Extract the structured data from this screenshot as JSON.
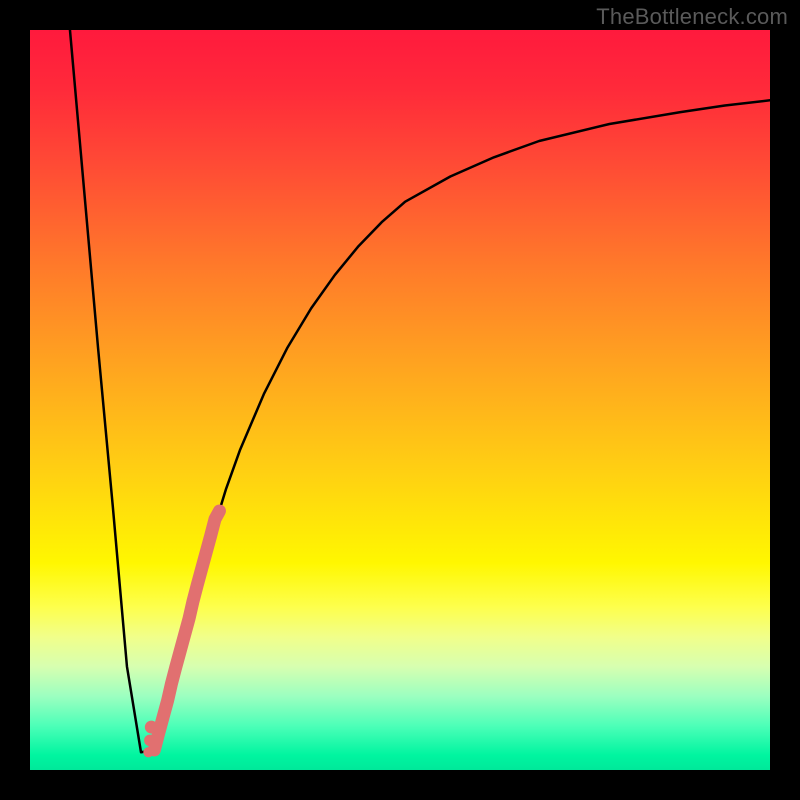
{
  "watermark": "TheBottleneck.com",
  "chart_data": {
    "type": "line",
    "title": "",
    "xlabel": "",
    "ylabel": "",
    "xlim": [
      0,
      100
    ],
    "ylim": [
      0,
      100
    ],
    "series": [
      {
        "name": "bottleneck-curve",
        "x": [
          5.4,
          7.3,
          9.2,
          11.2,
          13.1,
          15.0,
          16.8,
          18.7,
          20.6,
          22.6,
          24.5,
          26.5,
          28.4,
          31.6,
          34.8,
          38.0,
          41.2,
          44.4,
          47.6,
          50.7,
          56.8,
          62.7,
          68.8,
          78.3,
          87.9,
          93.9,
          100.0
        ],
        "y": [
          100.0,
          78.5,
          57.0,
          35.5,
          14.0,
          2.4,
          2.7,
          9.9,
          17.1,
          24.3,
          31.5,
          38.0,
          43.3,
          50.8,
          57.1,
          62.4,
          66.9,
          70.8,
          74.1,
          76.8,
          80.2,
          82.8,
          85.0,
          87.3,
          88.9,
          89.8,
          90.5
        ]
      },
      {
        "name": "highlight-segment",
        "x": [
          16.8,
          17.4,
          18.0,
          18.6,
          19.1,
          19.7,
          20.3,
          20.9,
          21.5,
          22.0,
          22.6,
          23.2,
          23.8,
          24.4,
          25.0,
          25.6
        ],
        "y": [
          2.7,
          5.0,
          7.2,
          9.4,
          11.6,
          13.9,
          16.1,
          18.3,
          20.5,
          22.7,
          25.0,
          27.2,
          29.4,
          31.6,
          33.9,
          35.0
        ]
      },
      {
        "name": "highlight-dots",
        "x": [
          16.4,
          16.2,
          16.0
        ],
        "y": [
          5.8,
          4.0,
          2.4
        ]
      }
    ]
  }
}
